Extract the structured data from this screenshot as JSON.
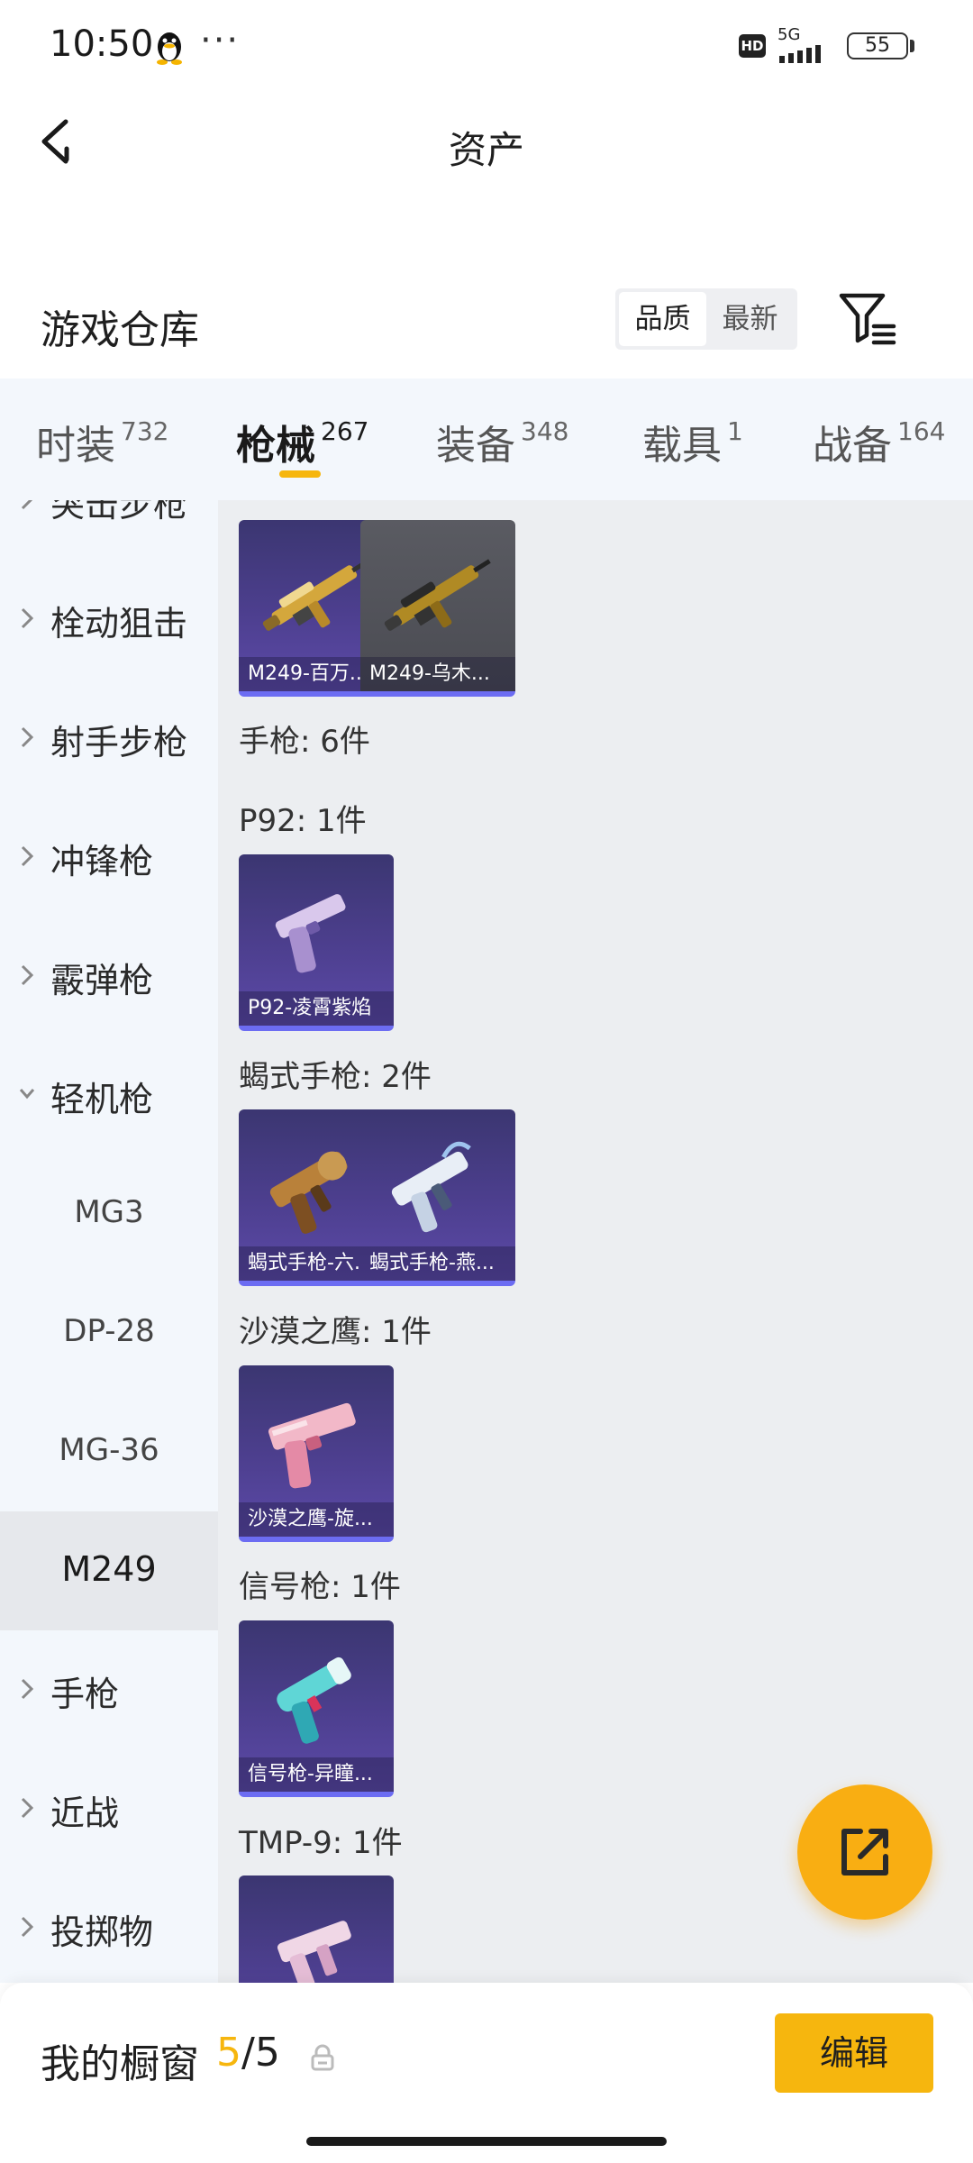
{
  "status_bar": {
    "time": "10:50",
    "more": "···",
    "hd": "HD",
    "network": "5G",
    "battery": "55"
  },
  "header": {
    "title": "资产"
  },
  "warehouse": {
    "title": "游戏仓库",
    "sort_options": [
      "品质",
      "最新"
    ],
    "active_sort": "品质"
  },
  "tabs": [
    {
      "label": "时装",
      "count": "732"
    },
    {
      "label": "枪械",
      "count": "267",
      "active": true
    },
    {
      "label": "装备",
      "count": "348"
    },
    {
      "label": "载具",
      "count": "1"
    },
    {
      "label": "战备",
      "count": "164"
    }
  ],
  "sidebar": {
    "partial_top": "突击步枪",
    "items": [
      {
        "label": "栓动狙击"
      },
      {
        "label": "射手步枪"
      },
      {
        "label": "冲锋枪"
      },
      {
        "label": "霰弹枪"
      },
      {
        "label": "轻机枪"
      },
      {
        "label": "MG3"
      },
      {
        "label": "DP-28"
      },
      {
        "label": "MG-36"
      },
      {
        "label": "M249"
      },
      {
        "label": "手枪"
      },
      {
        "label": "近战"
      },
      {
        "label": "投掷物"
      }
    ]
  },
  "content": {
    "m249_cards": [
      {
        "name": "M249-百万..."
      },
      {
        "name": "M249-乌木..."
      }
    ],
    "pistol_header": "手枪: 6件",
    "groups": [
      {
        "title": "P92: 1件",
        "cards": [
          {
            "name": "P92-凌霄紫焰"
          }
        ]
      },
      {
        "title": "蝎式手枪: 2件",
        "cards": [
          {
            "name": "蝎式手枪-六..."
          },
          {
            "name": "蝎式手枪-燕..."
          }
        ]
      },
      {
        "title": "沙漠之鹰: 1件",
        "cards": [
          {
            "name": "沙漠之鹰-旋..."
          }
        ]
      },
      {
        "title": "信号枪: 1件",
        "cards": [
          {
            "name": "信号枪-异瞳..."
          }
        ]
      },
      {
        "title": "TMP-9: 1件",
        "cards": []
      }
    ]
  },
  "bottom_bar": {
    "label": "我的橱窗",
    "current": "5",
    "total": "/5",
    "edit_label": "编辑"
  },
  "colors": {
    "accent": "#f6b60e",
    "card_purple": "#4d3f8f",
    "tab_bg": "#f3f7fc",
    "content_bg": "#eceef1"
  }
}
